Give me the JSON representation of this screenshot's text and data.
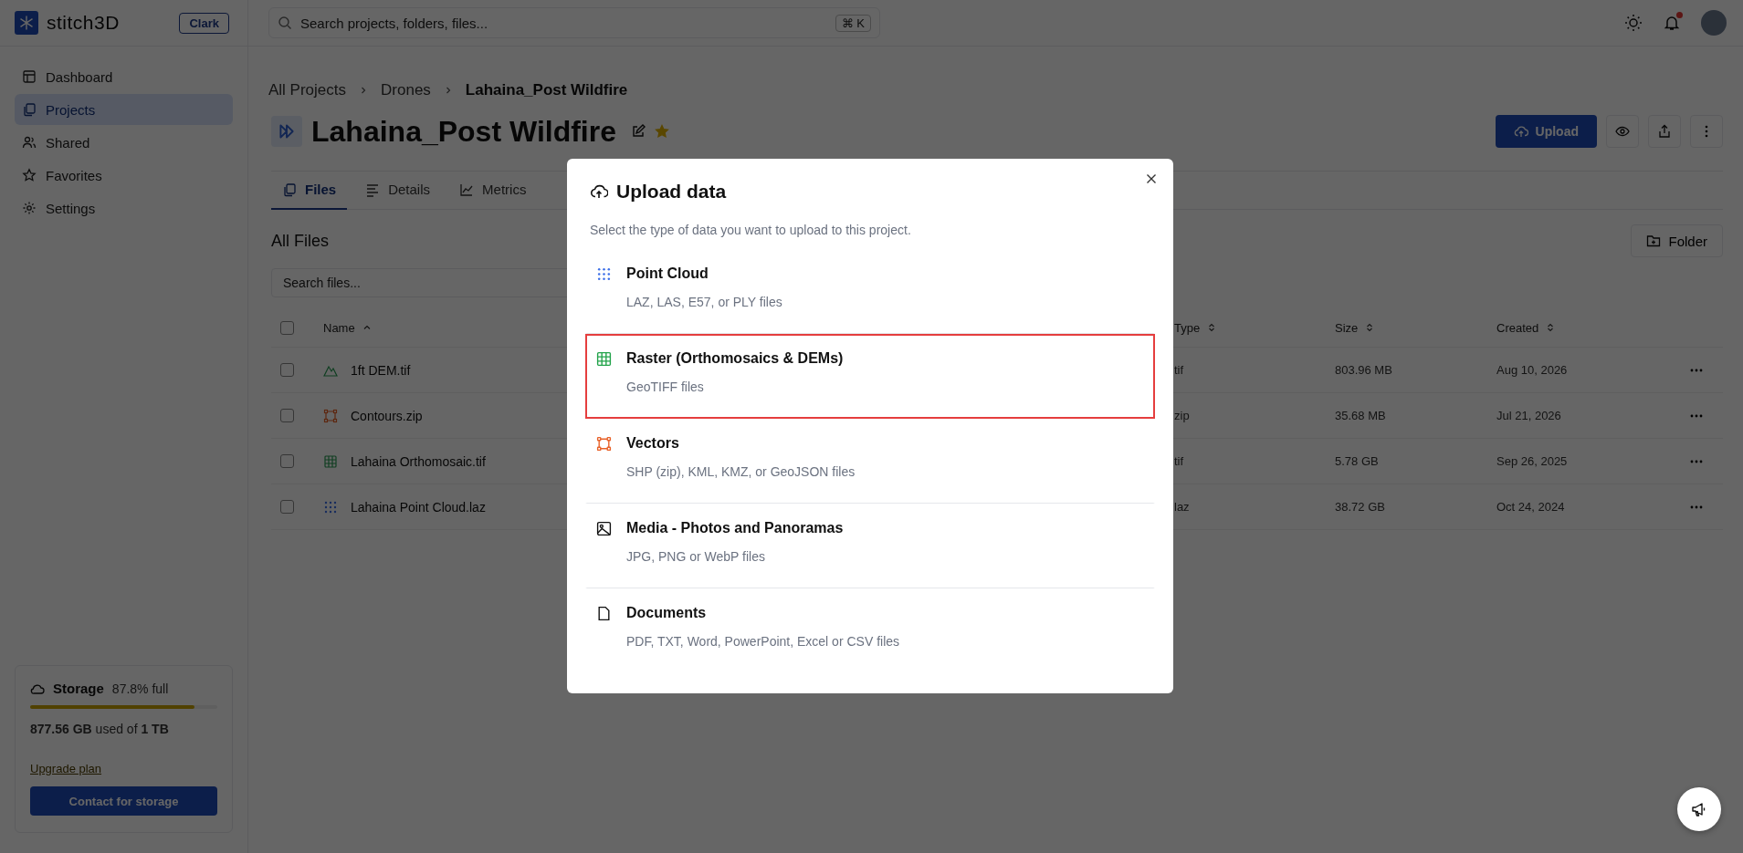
{
  "brand": {
    "name": "stitch3D",
    "workspace": "Clark"
  },
  "search": {
    "placeholder": "Search projects, folders, files...",
    "shortcut": "⌘ K"
  },
  "top_bar": {
    "has_notification": true
  },
  "sidebar": {
    "items": [
      {
        "label": "Dashboard",
        "selected": false
      },
      {
        "label": "Projects",
        "selected": true
      },
      {
        "label": "Shared",
        "selected": false
      },
      {
        "label": "Favorites",
        "selected": false
      },
      {
        "label": "Settings",
        "selected": false
      }
    ]
  },
  "storage": {
    "title": "Storage",
    "percent": "87.8% full",
    "level": 0.878,
    "usage": "**877.56 GB** used of **1 TB**",
    "upgrade_link": "Upgrade plan",
    "button": "Contact for storage"
  },
  "breadcrumbs": [
    {
      "label": "All Projects",
      "current": false
    },
    {
      "label": "Drones",
      "current": false
    },
    {
      "label": "Lahaina_Post Wildfire",
      "current": true
    }
  ],
  "project": {
    "title": "Lahaina_Post Wildfire",
    "favorite": true,
    "upload_button": "Upload"
  },
  "tabs": [
    {
      "label": "Files",
      "selected": true
    },
    {
      "label": "Details",
      "selected": false
    },
    {
      "label": "Metrics",
      "selected": false
    }
  ],
  "files": {
    "heading": "All Files",
    "select_all_checked": false,
    "folder_button": "Folder",
    "search_placeholder": "Search files...",
    "columns": [
      {
        "label": "Name",
        "sorted": true
      },
      {
        "label": "Type",
        "sorted": false
      },
      {
        "label": "Size",
        "sorted": false
      },
      {
        "label": "Created",
        "sorted": false
      }
    ],
    "rows": [
      {
        "kind": "dem",
        "name": "1ft DEM.tif",
        "type": "tif",
        "size": "803.96 MB",
        "created": "Aug 10, 2026",
        "checked": false
      },
      {
        "kind": "vector",
        "name": "Contours.zip",
        "type": "zip",
        "size": "35.68 MB",
        "created": "Jul 21, 2026",
        "checked": false
      },
      {
        "kind": "raster",
        "name": "Lahaina Orthomosaic.tif",
        "type": "tif",
        "size": "5.78 GB",
        "created": "Sep 26, 2025",
        "checked": false
      },
      {
        "kind": "pointcloud",
        "name": "Lahaina Point Cloud.laz",
        "type": "laz",
        "size": "38.72 GB",
        "created": "Oct 24, 2024",
        "checked": false
      }
    ]
  },
  "modal": {
    "title": "Upload data",
    "subtitle": "Select the type of data you want to upload to this project.",
    "options": [
      {
        "kind": "pointcloud",
        "title": "Point Cloud",
        "description": "LAZ, LAS, E57, or PLY files",
        "selected": false
      },
      {
        "kind": "raster",
        "title": "Raster (Orthomosaics & DEMs)",
        "description": "GeoTIFF files",
        "selected": true
      },
      {
        "kind": "vector",
        "title": "Vectors",
        "description": "SHP (zip), KML, KMZ, or GeoJSON files",
        "selected": false
      },
      {
        "kind": "media",
        "title": "Media - Photos and Panoramas",
        "description": "JPG, PNG or WebP files",
        "selected": false
      },
      {
        "kind": "document",
        "title": "Documents",
        "description": "PDF, TXT, Word, PowerPoint, Excel or CSV files",
        "selected": false
      }
    ]
  }
}
